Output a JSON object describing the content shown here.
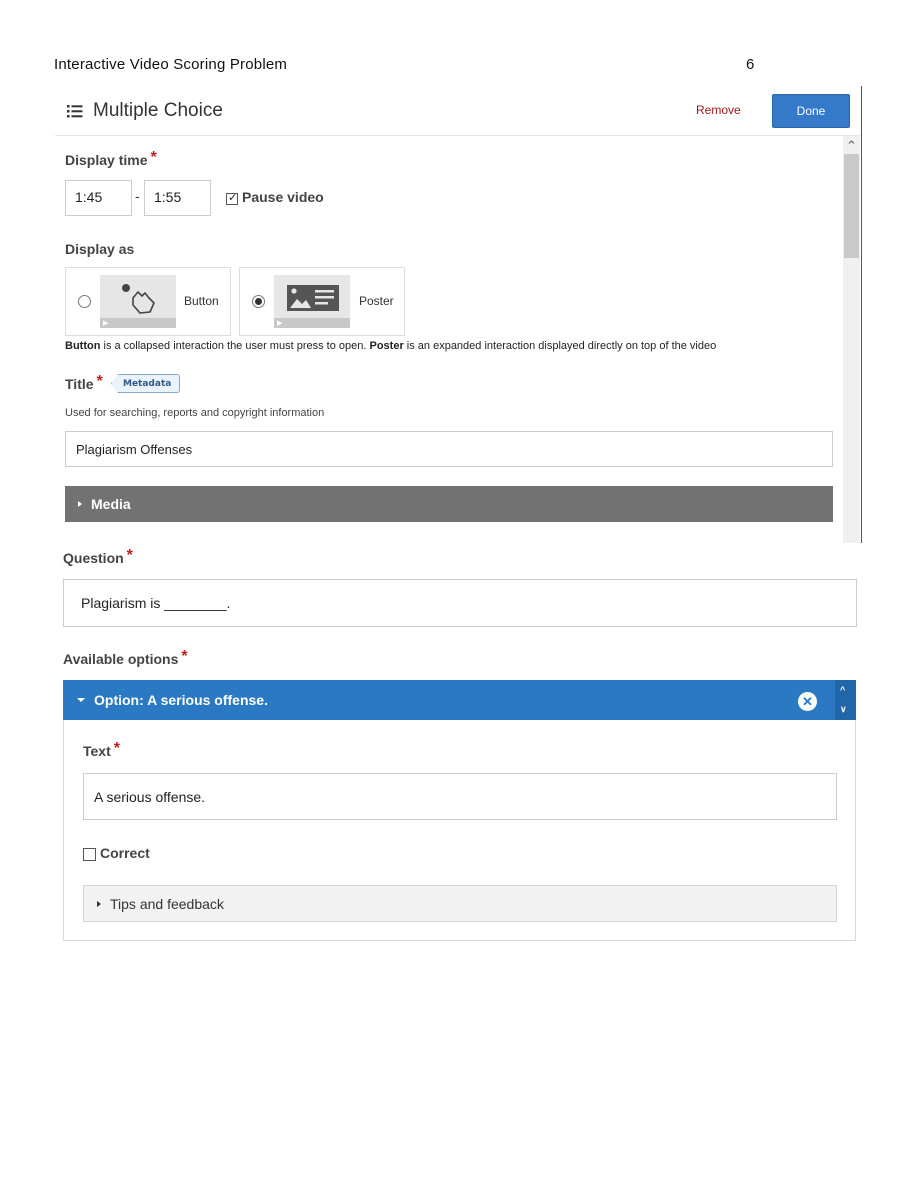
{
  "document": {
    "header": "Interactive Video Scoring Problem",
    "page_number": "6"
  },
  "editor": {
    "title": "Multiple Choice",
    "remove_label": "Remove",
    "done_label": "Done",
    "display_time": {
      "label": "Display time",
      "start": "1:45",
      "separator": "-",
      "end": "1:55",
      "pause_label": "Pause video",
      "pause_checked": true
    },
    "display_as": {
      "label": "Display as",
      "options": [
        {
          "label": "Button",
          "selected": false,
          "icon": "touch-pointer-icon"
        },
        {
          "label": "Poster",
          "selected": true,
          "icon": "poster-image-icon"
        }
      ],
      "desc_button": "Button",
      "desc_mid": " is a collapsed interaction the user must press to open. ",
      "desc_poster": "Poster",
      "desc_end": " is an expanded interaction displayed directly on top of the video"
    },
    "title_field": {
      "label": "Title",
      "metadata_label": "Metadata",
      "help": "Used for searching, reports and copyright information",
      "value": "Plagiarism Offenses"
    },
    "media_label": "Media"
  },
  "question": {
    "label": "Question",
    "value": "Plagiarism is ________."
  },
  "available_options": {
    "label": "Available options",
    "option": {
      "header": "Option: A serious offense.",
      "text_label": "Text",
      "text_value": "A serious offense.",
      "correct_label": "Correct",
      "correct_checked": false,
      "tips_label": "Tips and feedback"
    }
  },
  "colors": {
    "accent": "#2b79c2",
    "done_button": "#3579c9",
    "remove": "#a4161a",
    "required": "#c21d1d",
    "media_bar": "#727272"
  }
}
